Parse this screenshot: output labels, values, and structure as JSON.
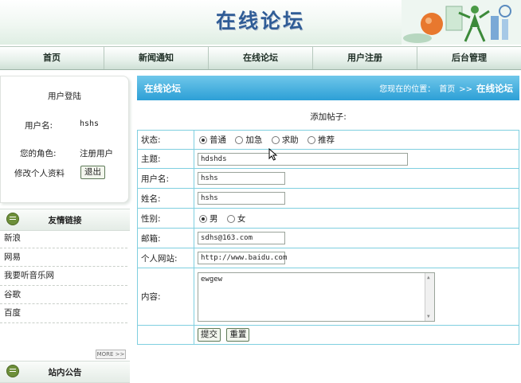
{
  "header": {
    "site_title": "在线论坛"
  },
  "nav": [
    "首页",
    "新闻通知",
    "在线论坛",
    "用户注册",
    "后台管理"
  ],
  "login": {
    "title": "用户登陆",
    "username_label": "用户名:",
    "username_value": "hshs",
    "role_label": "您的角色:",
    "role_value": "注册用户",
    "edit_profile": "修改个人资料",
    "logout": "退出"
  },
  "links_section": {
    "title": "友情链接",
    "items": [
      "新浪",
      "网易",
      "我要听音乐网",
      "谷歌",
      "百度"
    ],
    "more": "MORE >>"
  },
  "notice_section": {
    "title": "站内公告"
  },
  "main": {
    "title": "在线论坛",
    "breadcrumb_prefix": "您现在的位置：",
    "breadcrumb_home": "首页",
    "breadcrumb_sep": ">>",
    "breadcrumb_current": "在线论坛",
    "caption": "添加帖子:"
  },
  "form": {
    "status_label": "状态:",
    "status_options": [
      "普通",
      "加急",
      "求助",
      "推荐"
    ],
    "status_selected": "普通",
    "subject_label": "主题:",
    "subject_value": "hdshds",
    "username_label": "用户名:",
    "username_value": "hshs",
    "name_label": "姓名:",
    "name_value": "hshs",
    "gender_label": "性别:",
    "gender_options": [
      "男",
      "女"
    ],
    "gender_selected": "男",
    "email_label": "邮箱:",
    "email_value": "sdhs@163.com",
    "website_label": "个人网站:",
    "website_value": "http://www.baidu.com",
    "content_label": "内容:",
    "content_value": "ewgew",
    "submit": "提交",
    "reset": "重置"
  },
  "colors": {
    "accent": "#2c9fd6",
    "table_border": "#7fcfe0",
    "title": "#2f5c96"
  }
}
